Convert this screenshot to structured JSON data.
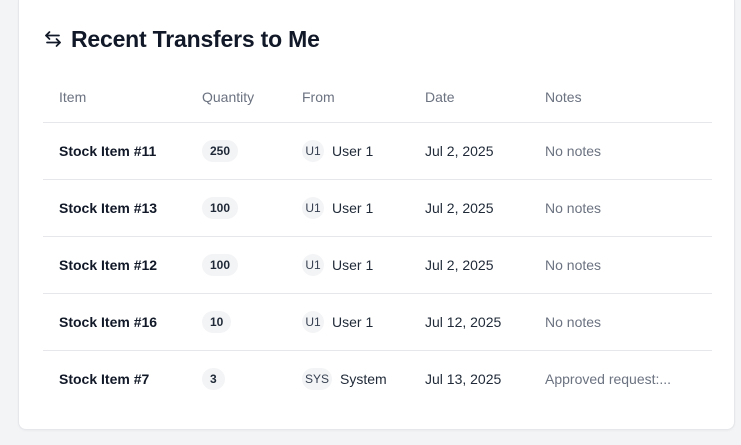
{
  "card": {
    "title": "Recent Transfers to Me",
    "icon": "arrows-left-right-icon"
  },
  "table": {
    "columns": [
      "Item",
      "Quantity",
      "From",
      "Date",
      "Notes"
    ],
    "rows": [
      {
        "item": "Stock Item #11",
        "quantity": "250",
        "from_initials": "U1",
        "from_name": "User 1",
        "date": "Jul 2, 2025",
        "notes": "No notes"
      },
      {
        "item": "Stock Item #13",
        "quantity": "100",
        "from_initials": "U1",
        "from_name": "User 1",
        "date": "Jul 2, 2025",
        "notes": "No notes"
      },
      {
        "item": "Stock Item #12",
        "quantity": "100",
        "from_initials": "U1",
        "from_name": "User 1",
        "date": "Jul 2, 2025",
        "notes": "No notes"
      },
      {
        "item": "Stock Item #16",
        "quantity": "10",
        "from_initials": "U1",
        "from_name": "User 1",
        "date": "Jul 12, 2025",
        "notes": "No notes"
      },
      {
        "item": "Stock Item #7",
        "quantity": "3",
        "from_initials": "SYS",
        "from_name": "System",
        "date": "Jul 13, 2025",
        "notes": "Approved request:..."
      }
    ]
  },
  "colors": {
    "page_bg": "#f3f4f6",
    "card_bg": "#ffffff",
    "border": "#e5e7eb",
    "muted_text": "#6b7280",
    "pill_bg": "#f3f4f6"
  }
}
